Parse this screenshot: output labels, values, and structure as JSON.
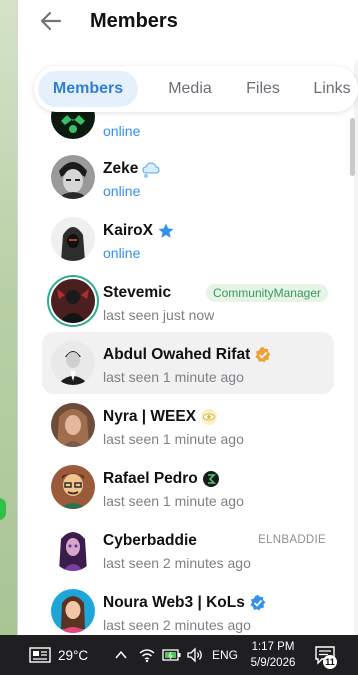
{
  "header": {
    "title": "Members"
  },
  "tabs": [
    {
      "label": "Members",
      "active": true
    },
    {
      "label": "Media",
      "active": false
    },
    {
      "label": "Files",
      "active": false
    },
    {
      "label": "Links",
      "active": false
    }
  ],
  "members": [
    {
      "name": "",
      "status": "online",
      "online": true
    },
    {
      "name": "Zeke",
      "status": "online",
      "online": true,
      "badge": "cloud-emoji-icon"
    },
    {
      "name": "KairoX",
      "status": "online",
      "online": true,
      "badge": "star-icon"
    },
    {
      "name": "Stevemic",
      "status": "last seen just now",
      "online": false,
      "role": "CommunityManager"
    },
    {
      "name": "Abdul Owahed Rifat",
      "status": "last seen 1 minute ago",
      "online": false,
      "badge": "verified-orange-icon"
    },
    {
      "name": "Nyra | WEEX",
      "status": "last seen 1 minute ago",
      "online": false,
      "badge": "eye-emoji-icon"
    },
    {
      "name": "Rafael Pedro",
      "status": "last seen 1 minute ago",
      "online": false,
      "badge": "emoji-badge-icon"
    },
    {
      "name": "Cyberbaddie",
      "status": "last seen 2 minutes ago",
      "online": false,
      "role_text": "ELNBADDIE"
    },
    {
      "name": "Noura Web3 | KoLs",
      "status": "last seen 2 minutes ago",
      "online": false,
      "badge": "verified-blue-icon"
    }
  ],
  "taskbar": {
    "temperature": "29°C",
    "language": "ENG",
    "time": "1:17 PM",
    "date": "5/9/2026",
    "notification_count": "11"
  },
  "colors": {
    "accent": "#3390ec",
    "tab_active_bg": "#e6f0fb",
    "role_tag_bg": "#e5f4e6",
    "role_tag_text": "#3a9a5b",
    "taskbar_bg": "#1f1f22"
  }
}
